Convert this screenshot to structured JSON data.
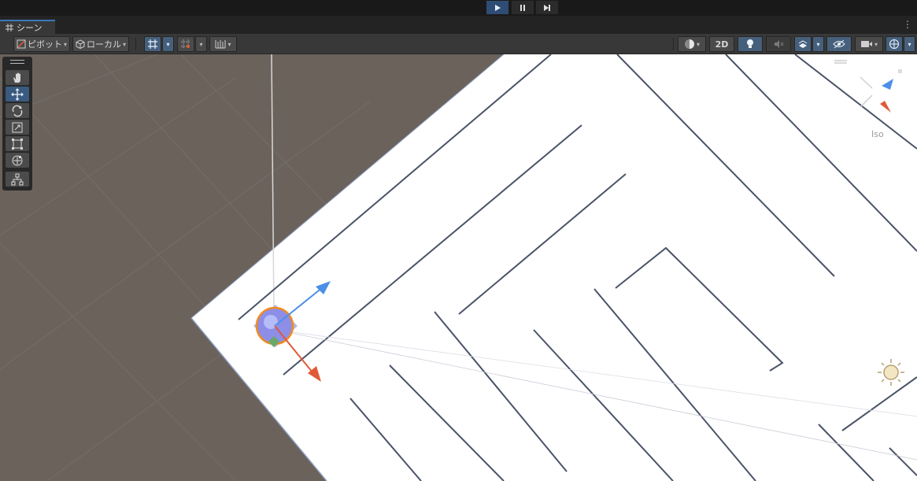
{
  "play_controls": {
    "play_icon": "play-icon",
    "pause_icon": "pause-icon",
    "step_icon": "step-icon",
    "play_active": true
  },
  "scene_tab": {
    "icon": "grid-icon",
    "label": "シーン",
    "more_icon": "vertical-ellipsis-icon",
    "more_glyph": "⋮"
  },
  "toolbar": {
    "pivot_label": "ピボット",
    "local_label": "ローカル",
    "snap_icon": "grid-snap-icon",
    "increment_snap_icon": "increment-snap-icon",
    "ruler_icon": "ruler-icon",
    "shading_icon": "shading-mode-icon",
    "two_d_label": "2D",
    "lighting_icon": "lightbulb-icon",
    "audio_icon": "audio-mute-icon",
    "effects_icon": "effects-icon",
    "hidden_icon": "visibility-icon",
    "camera_icon": "camera-icon",
    "gizmos_icon": "gizmos-icon",
    "dropdown_glyph": "▾"
  },
  "tools": [
    {
      "name": "hand-tool",
      "icon": "hand-icon",
      "active": false
    },
    {
      "name": "move-tool",
      "icon": "move-icon",
      "active": true
    },
    {
      "name": "rotate-tool",
      "icon": "rotate-icon",
      "active": false
    },
    {
      "name": "scale-tool",
      "icon": "scale-icon",
      "active": false
    },
    {
      "name": "rect-tool",
      "icon": "rect-icon",
      "active": false
    },
    {
      "name": "transform-tool",
      "icon": "transform-icon",
      "active": false
    },
    {
      "name": "custom-tool",
      "icon": "custom-tool-icon",
      "active": false
    }
  ],
  "orientation": {
    "mode_label": "Iso"
  },
  "colors": {
    "viewport_bg": "#6b625c",
    "maze_floor": "#ffffff",
    "maze_wall": "#4a5368",
    "axis_blue": "#4d8fe6",
    "axis_red": "#e05a38",
    "selection": "#f28b1f",
    "accent": "#3a79bb"
  }
}
